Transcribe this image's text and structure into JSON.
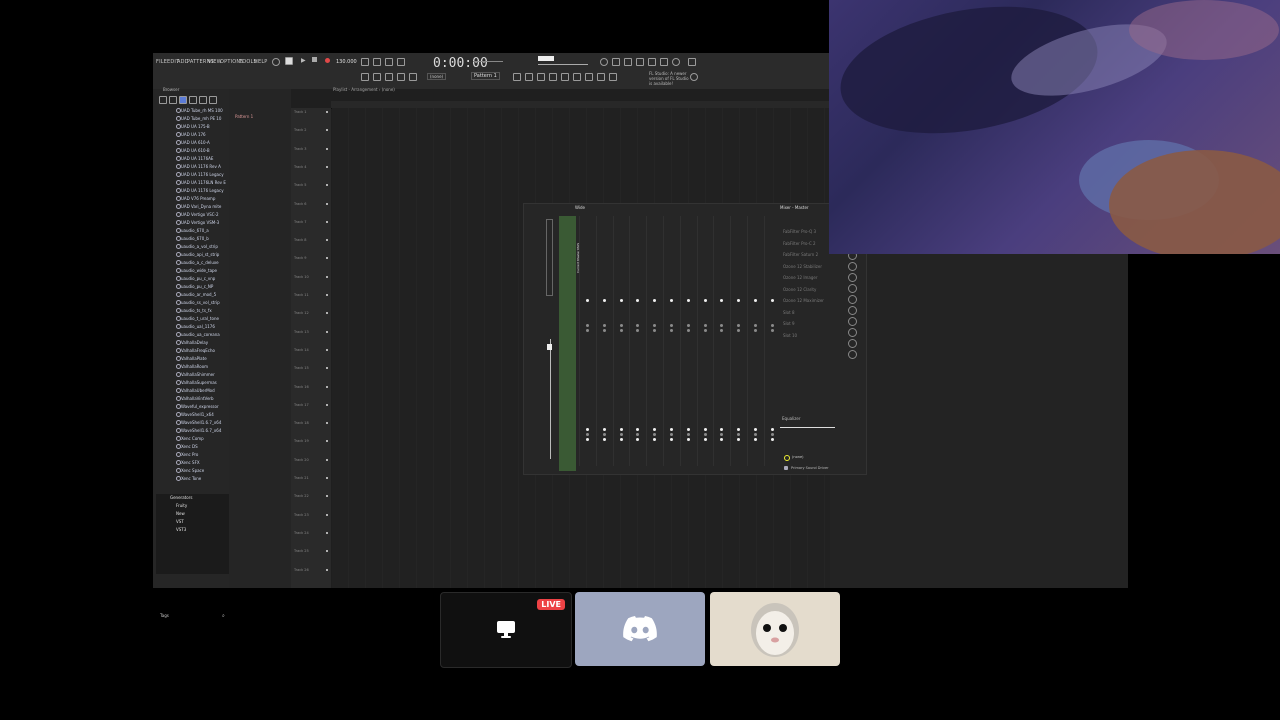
{
  "menu": {
    "items": [
      "FILE",
      "EDIT",
      "ADD",
      "PATTERNS",
      "VIEW",
      "OPTIONS",
      "TOOLS",
      "HELP"
    ],
    "bpm": "130.000",
    "time": "0:00:00",
    "pattern": "Pattern 1",
    "hint": "FL Studio: A newer version of FL Studio is available!"
  },
  "browser": {
    "header": "Browser",
    "plugins": [
      "UAD Tube_rh MS 100",
      "UAD Tube_mh PE 10",
      "UAD UA 175-B",
      "UAD UA 176",
      "UAD UA 610-A",
      "UAD UA 610-B",
      "UAD UA 1176AE",
      "UAD UA 1176 Rev A",
      "UAD UA 1176 Legacy",
      "UAD UA 1176LN Rev E",
      "UAD UA 1176 Legacy",
      "UAD V76 Preamp",
      "UAD Vari_Dyna mite",
      "UAD Vertigo VSC-2",
      "UAD Vertigo VSM-3",
      "uaudio_670_a",
      "uaudio_670_b",
      "uaudio_a_vol_strip",
      "uaudio_api_st_strip",
      "uaudio_a_c_deluxe",
      "uaudio_wide_tape",
      "uaudio_pu_c_vnp",
      "uaudio_pu_c_NP",
      "uaudio_ar_mod_5",
      "uaudio_ss_vol_strip",
      "uaudio_ts_ts_fx",
      "uaudio_t_ural_tone",
      "uaudio_ual_1176",
      "uaudio_ua_coreana",
      "ValhallaDelay",
      "ValhallaFreqEcho",
      "ValhallaPlate",
      "ValhallaRoom",
      "ValhallaShimmer",
      "ValhallaSupermas",
      "ValhallaUberMod",
      "ValhallaVintVerb",
      "Waveful_expressor",
      "WaveShell1_x64",
      "WaveShell1.6.7_x64",
      "WaveShell1.6.7_x64",
      "Xenc Comp",
      "Xenc DS",
      "Xenc Pro",
      "Xenc SFX",
      "Xenc Space",
      "Xenc Tone"
    ],
    "generators_label": "Generators",
    "generators": [
      "Fruity",
      "New",
      "VST",
      "VST3"
    ],
    "tags_label": "Tags"
  },
  "patterns": {
    "item": "Pattern 1"
  },
  "playlist": {
    "title": "Playlist - Arrangement › (none)",
    "tracks": [
      "Track 1",
      "Track 2",
      "Track 3",
      "Track 4",
      "Track 5",
      "Track 6",
      "Track 7",
      "Track 8",
      "Track 9",
      "Track 10",
      "Track 11",
      "Track 12",
      "Track 13",
      "Track 14",
      "Track 15",
      "Track 16",
      "Track 17",
      "Track 18",
      "Track 19",
      "Track 20",
      "Track 21",
      "Track 22",
      "Track 23",
      "Track 24",
      "Track 25",
      "Track 26"
    ]
  },
  "mixer": {
    "title": "Wide",
    "master_title": "Mixer - Master",
    "master_label": "Current Master MAS",
    "fx_slots": [
      "FabFilter Pro-Q 3",
      "FabFilter Pro-C 2",
      "FabFilter Saturn 2",
      "Ozone 12 Stabilizer",
      "Ozone 12 Imager",
      "Ozone 12 Clarity",
      "Ozone 12 Maximizer",
      "Slot 8",
      "Slot 9",
      "Slot 10"
    ],
    "eq_label": "Equalizer",
    "input_none": "(none)",
    "output_device": "Primary Sound Driver"
  },
  "tiles": {
    "live": "LIVE"
  },
  "colors": {
    "accent": "#3a5a34",
    "live": "#ed4245",
    "discord": "#9da6bf"
  }
}
